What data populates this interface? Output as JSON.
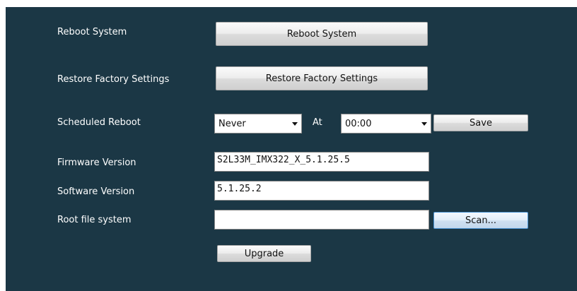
{
  "rows": {
    "reboot": {
      "label": "Reboot System",
      "button": "Reboot System"
    },
    "restore": {
      "label": "Restore Factory Settings",
      "button": "Restore Factory Settings"
    },
    "scheduled": {
      "label": "Scheduled Reboot",
      "frequency": "Never",
      "at_label": "At",
      "time": "00:00",
      "save_button": "Save"
    },
    "firmware": {
      "label": "Firmware Version",
      "value": "S2L33M_IMX322_X_5.1.25.5"
    },
    "software": {
      "label": "Software Version",
      "value": "5.1.25.2"
    },
    "rootfs": {
      "label": "Root file system",
      "value": "",
      "scan_button": "Scan..."
    }
  },
  "upgrade_button": "Upgrade",
  "colors": {
    "panel_background": "#1b3745",
    "label_text": "#ffffff",
    "scan_button_border": "#4f97d6"
  }
}
